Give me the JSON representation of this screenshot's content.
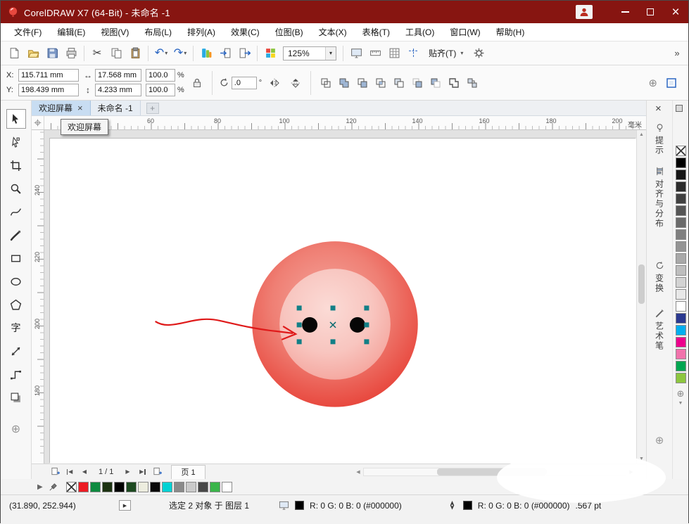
{
  "window": {
    "title": "CorelDRAW X7 (64-Bit) - 未命名 -1"
  },
  "menu": {
    "items": [
      "文件(F)",
      "编辑(E)",
      "视图(V)",
      "布局(L)",
      "排列(A)",
      "效果(C)",
      "位图(B)",
      "文本(X)",
      "表格(T)",
      "工具(O)",
      "窗口(W)",
      "帮助(H)"
    ]
  },
  "toolbar": {
    "zoom_level": "125%",
    "snap_label": "贴齐(T)",
    "overflow_glyph": "»"
  },
  "property_bar": {
    "x_label": "X:",
    "x_value": "115.711 mm",
    "y_label": "Y:",
    "y_value": "198.439 mm",
    "width_value": "17.568 mm",
    "height_value": "4.233 mm",
    "scale_w": "100.0",
    "scale_h": "100.0",
    "percent": "%",
    "angle_value": ".0",
    "degree": "°"
  },
  "doc_tabs": {
    "welcome_tab": "欢迎屏幕",
    "doc_tab": "未命名 -1",
    "close_glyph": "×",
    "add_glyph": "+",
    "tooltip": "欢迎屏幕"
  },
  "rulers": {
    "h_ticks": [
      "60",
      "80",
      "100",
      "120",
      "140",
      "160",
      "180",
      "200"
    ],
    "unit": "毫米",
    "v_ticks": [
      "240",
      "220",
      "200",
      "180"
    ]
  },
  "toolbox": {
    "text_tool_glyph": "字"
  },
  "dockers": {
    "tabs": [
      "提示",
      "对齐与分布",
      "变换",
      "艺术笔"
    ]
  },
  "page_nav": {
    "position": "1 / 1",
    "page_tab": "页 1"
  },
  "right_palette": {
    "swatches": [
      "none",
      "#000000",
      "#161616",
      "#2b2b2b",
      "#404040",
      "#555555",
      "#6a6a6a",
      "#7f7f7f",
      "#949494",
      "#a9a9a9",
      "#bebebe",
      "#d3d3d3",
      "#e8e8e8",
      "#ffffff",
      "#2b3990",
      "#00aeef",
      "#ec008c",
      "#f173ac",
      "#00a651",
      "#8dc63f"
    ]
  },
  "doc_palette": {
    "swatches": [
      "none",
      "#ed1c24",
      "#0e8a40",
      "#1c3311",
      "#000000",
      "#1d4a21",
      "#ededdf",
      "#0a0a0a",
      "#00d2d4",
      "#8a8a8a",
      "#cacaca",
      "#484848",
      "#3ab54a",
      "#ffffff"
    ]
  },
  "status_bar": {
    "coords": "(31.890, 252.944)",
    "selection_text": "选定 2 对象 于 图层 1",
    "fill_label": "R: 0 G: 0 B: 0 (#000000)",
    "outline_label": "R: 0 G: 0 B: 0 (#000000)",
    "outline_width": ".567 pt"
  },
  "artwork": {
    "outer_color": "#e8493f",
    "inner_color": "#f8c5bf",
    "hole_color": "#060606",
    "handle_color": "#127f86",
    "arrow_color": "#df1a1a"
  }
}
